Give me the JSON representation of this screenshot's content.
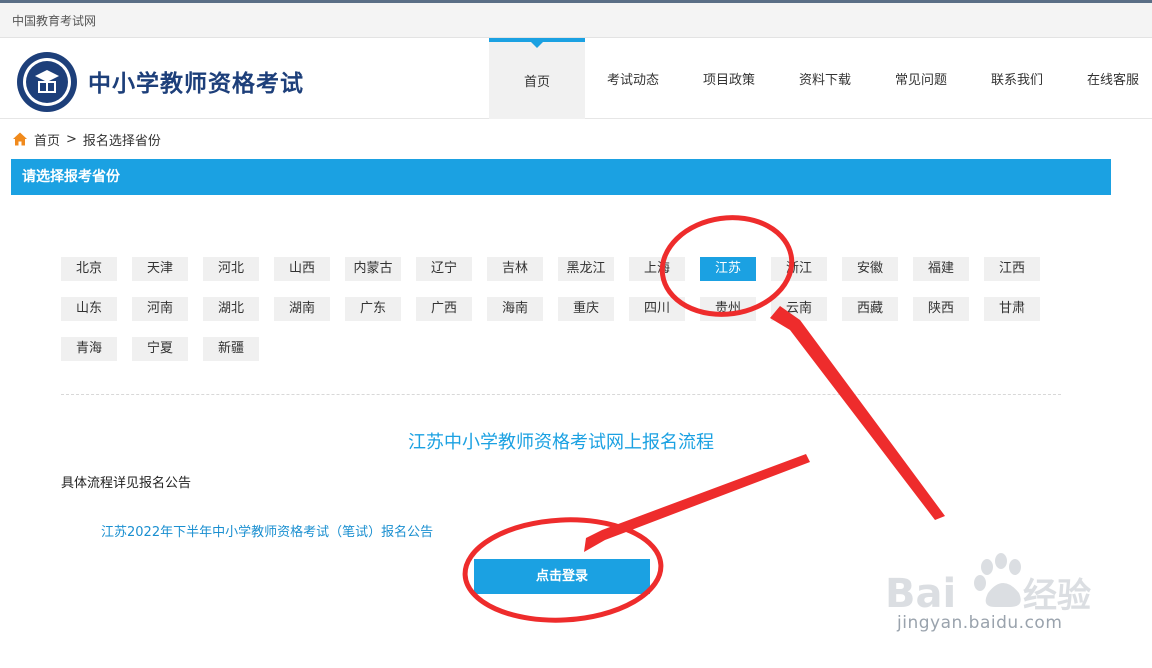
{
  "topbar": {
    "site_name": "中国教育考试网"
  },
  "header": {
    "title": "中小学教师资格考试",
    "nav": [
      {
        "label": "首页",
        "active": true
      },
      {
        "label": "考试动态"
      },
      {
        "label": "项目政策"
      },
      {
        "label": "资料下载"
      },
      {
        "label": "常见问题"
      },
      {
        "label": "联系我们"
      },
      {
        "label": "在线客服"
      }
    ]
  },
  "breadcrumb": {
    "home": "首页",
    "separator": ">",
    "current": "报名选择省份"
  },
  "section": {
    "title": "请选择报考省份"
  },
  "provinces": {
    "selected": "江苏",
    "rows": [
      [
        "北京",
        "天津",
        "河北",
        "山西",
        "内蒙古",
        "辽宁",
        "吉林",
        "黑龙江",
        "上海",
        "江苏",
        "浙江",
        "安徽",
        "福建",
        "江西"
      ],
      [
        "山东",
        "河南",
        "湖北",
        "湖南",
        "广东",
        "广西",
        "海南",
        "重庆",
        "四川",
        "贵州",
        "云南",
        "西藏",
        "陕西",
        "甘肃"
      ],
      [
        "青海",
        "宁夏",
        "新疆"
      ]
    ]
  },
  "flow": {
    "title": "江苏中小学教师资格考试网上报名流程",
    "note": "具体流程详见报名公告",
    "notice_link": "江苏2022年下半年中小学教师资格考试（笔试）报名公告",
    "login_label": "点击登录"
  },
  "watermark": {
    "text": "jingyan.baidu.com"
  },
  "colors": {
    "accent": "#1ba1e2",
    "title": "#1d3f7a",
    "annotation": "#ee2c2c"
  }
}
